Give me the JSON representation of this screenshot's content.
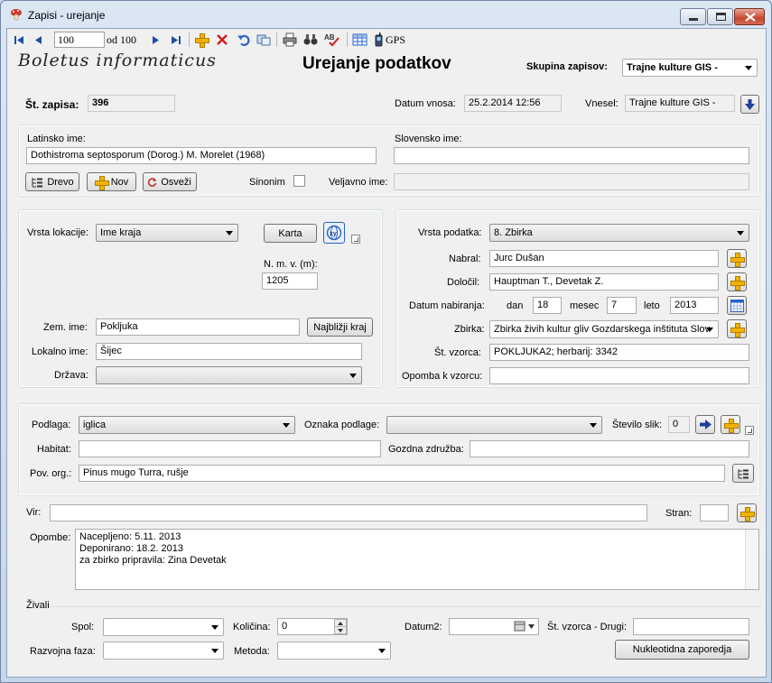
{
  "window": {
    "title": "Zapisi - urejanje"
  },
  "toolbar": {
    "record": "100",
    "of_label": "od 100",
    "gps": "GPS"
  },
  "header": {
    "brand": "Boletus informaticus",
    "title": "Urejanje podatkov",
    "group_label": "Skupina zapisov:",
    "group_value": "Trajne kulture GIS -"
  },
  "record": {
    "num_label": "Št. zapisa:",
    "num_value": "396",
    "date_label": "Datum vnosa:",
    "date_value": "25.2.2014 12:56",
    "by_label": "Vnesel:",
    "by_value": "Trajne kulture GIS -"
  },
  "names": {
    "latin_label": "Latinsko ime:",
    "latin_value": "Dothistroma septosporum (Dorog.) M. Morelet (1968)",
    "slo_label": "Slovensko ime:",
    "slo_value": "",
    "tree_btn": "Drevo",
    "new_btn": "Nov",
    "refresh_btn": "Osveži",
    "synonym_label": "Sinonim",
    "valid_label": "Veljavno ime:",
    "valid_value": ""
  },
  "location": {
    "type_label": "Vrsta lokacije:",
    "type_value": "Ime kraja",
    "map_btn": "Karta",
    "alt_label": "N. m. v. (m):",
    "alt_value": "1205",
    "geo_label": "Zem. ime:",
    "geo_value": "Pokljuka",
    "nearest_btn": "Najbližji kraj",
    "local_label": "Lokalno ime:",
    "local_value": "Šijec",
    "country_label": "Država:",
    "country_value": ""
  },
  "data": {
    "type_label": "Vrsta podatka:",
    "type_value": "8. Zbirka",
    "collector_label": "Nabral:",
    "collector_value": "Jurc Dušan",
    "determ_label": "Določil:",
    "determ_value": "Hauptman T., Devetak Z.",
    "date_label": "Datum nabiranja:",
    "day_label": "dan",
    "day_value": "18",
    "month_label": "mesec",
    "month_value": "7",
    "year_label": "leto",
    "year_value": "2013",
    "coll_label": "Zbirka:",
    "coll_value": "Zbirka živih kultur gliv Gozdarskega inštituta Slov",
    "sample_label": "Št. vzorca:",
    "sample_value": "POKLJUKA2; herbarij: 3342",
    "note_label": "Opomba k vzorcu:",
    "note_value": ""
  },
  "substrate": {
    "label": "Podlaga:",
    "value": "iglica",
    "mark_label": "Oznaka podlage:",
    "mark_value": "",
    "images_label": "Število slik:",
    "images_value": "0",
    "habitat_label": "Habitat:",
    "habitat_value": "",
    "forest_label": "Gozdna združba:",
    "forest_value": "",
    "org_label": "Pov. org.:",
    "org_value": "Pinus mugo Turra, rušje"
  },
  "source": {
    "label": "Vir:",
    "value": "",
    "page_label": "Stran:",
    "page_value": ""
  },
  "notes": {
    "label": "Opombe:",
    "value": "Nacepljeno: 5.11. 2013\nDeponirano: 18.2. 2013\nza zbirko pripravila: Zina Devetak"
  },
  "animals": {
    "group": "Živali",
    "sex_label": "Spol:",
    "sex_value": "",
    "qty_label": "Količina:",
    "qty_value": "0",
    "date2_label": "Datum2:",
    "date2_value": "",
    "other_label": "Št. vzorca - Drugi:",
    "other_value": "",
    "stage_label": "Razvojna faza:",
    "stage_value": "",
    "method_label": "Metoda:",
    "method_value": "",
    "seq_btn": "Nukleotidna zaporedja"
  }
}
